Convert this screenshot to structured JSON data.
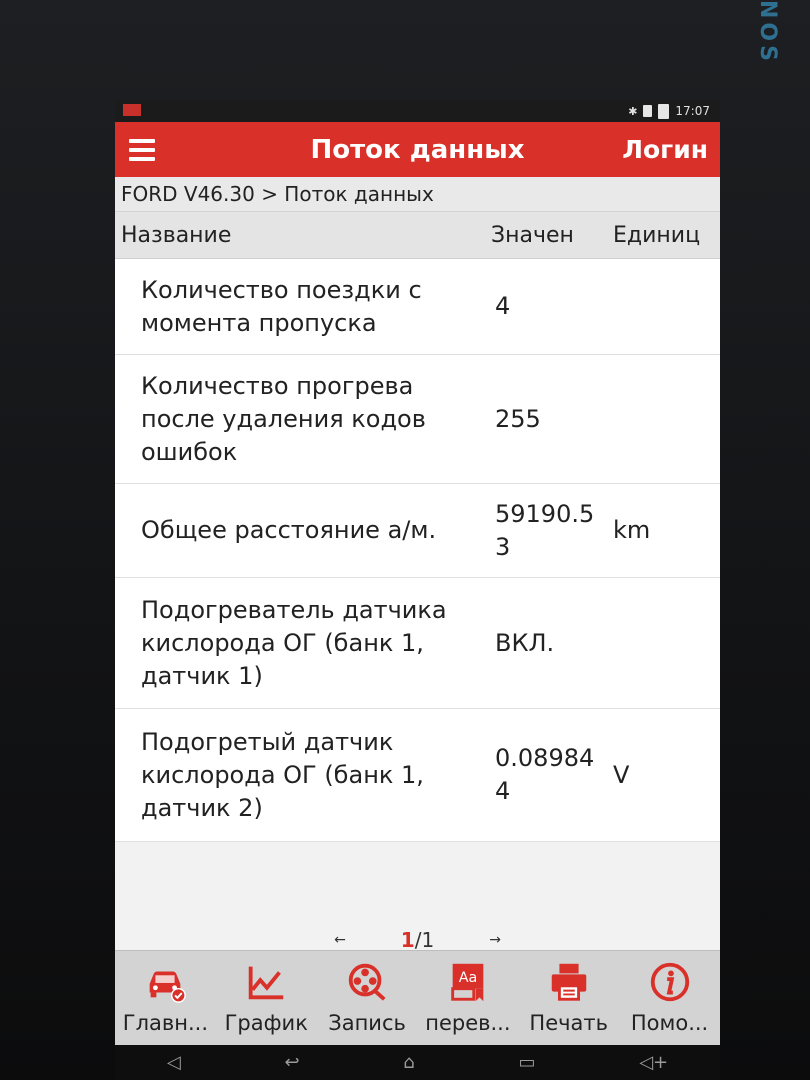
{
  "device": {
    "brand": "NOS"
  },
  "statusbar": {
    "time": "17:07"
  },
  "appbar": {
    "title": "Поток данных",
    "login": "Логин"
  },
  "breadcrumb": "FORD V46.30 > Поток данных",
  "columns": {
    "name": "Название",
    "value": "Значен",
    "unit": "Единиц"
  },
  "rows": [
    {
      "name": "Количество поездки с момента пропуска",
      "value": "4",
      "unit": ""
    },
    {
      "name": "Количество прогрева после удаления кодов ошибок",
      "value": "255",
      "unit": ""
    },
    {
      "name": "Общее расстояние а/м.",
      "value": "59190.53",
      "unit": "km"
    },
    {
      "name": "Подогреватель датчика кислорода ОГ (банк 1, датчик 1)",
      "value": "ВКЛ.",
      "unit": ""
    },
    {
      "name": "Подогретый датчик кислорода ОГ (банк 1, датчик 2)",
      "value": "0.089844",
      "unit": "V"
    }
  ],
  "pager": {
    "prev": "←",
    "current": "1",
    "separator": "/",
    "total": "1",
    "next": "→"
  },
  "toolbar": [
    {
      "label": "Главн...",
      "icon": "car-check-icon"
    },
    {
      "label": "График",
      "icon": "graph-icon"
    },
    {
      "label": "Запись",
      "icon": "film-reel-icon"
    },
    {
      "label": "перев...",
      "icon": "translate-icon"
    },
    {
      "label": "Печать",
      "icon": "printer-icon"
    },
    {
      "label": "Помо...",
      "icon": "info-icon"
    }
  ],
  "colors": {
    "accent": "#d9302a",
    "toolbar_bg": "#d3d3d3"
  }
}
